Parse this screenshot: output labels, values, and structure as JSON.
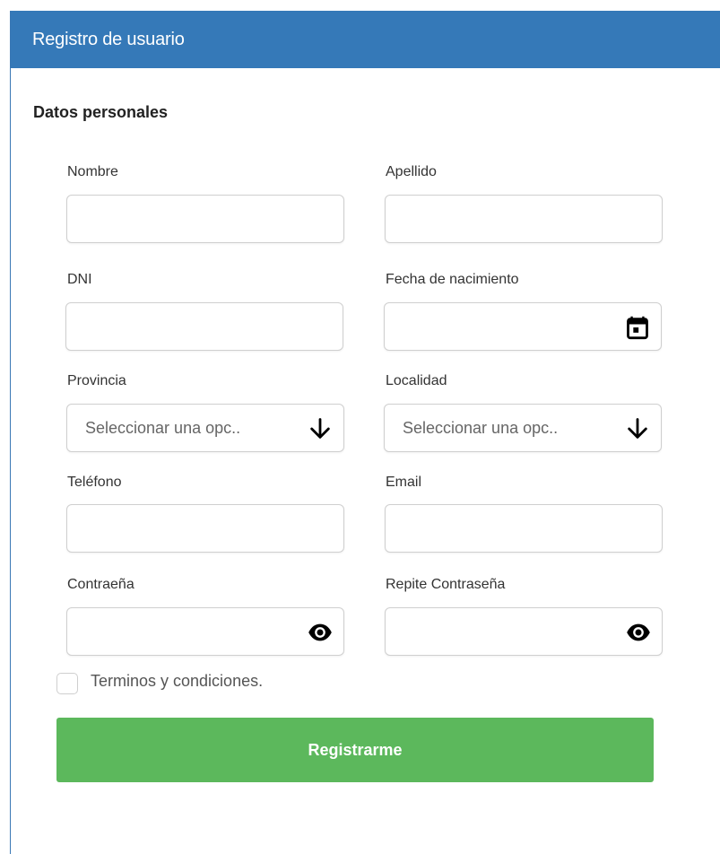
{
  "header": {
    "title": "Registro de usuario"
  },
  "section": {
    "title": "Datos personales"
  },
  "fields": {
    "nombre": {
      "label": "Nombre",
      "value": ""
    },
    "apellido": {
      "label": "Apellido",
      "value": ""
    },
    "dni": {
      "label": "DNI",
      "value": ""
    },
    "fecha": {
      "label": "Fecha de nacimiento",
      "value": "",
      "icon": "calendar-icon"
    },
    "provincia": {
      "label": "Provincia",
      "selected": "Seleccionar una opc..",
      "icon": "arrow-down-icon"
    },
    "localidad": {
      "label": "Localidad",
      "selected": "Seleccionar una opc..",
      "icon": "arrow-down-icon"
    },
    "telefono": {
      "label": "Teléfono",
      "value": ""
    },
    "email": {
      "label": "Email",
      "value": ""
    },
    "password": {
      "label": "Contraeña",
      "value": "",
      "icon": "eye-icon"
    },
    "password_repeat": {
      "label": "Repite Contraseña",
      "value": "",
      "icon": "eye-icon"
    }
  },
  "terms": {
    "label": "Terminos y condiciones.",
    "checked": false
  },
  "submit": {
    "label": "Registrarme"
  },
  "colors": {
    "header": "#3579b8",
    "submit": "#5cb85c",
    "border": "#cfcfcf"
  }
}
